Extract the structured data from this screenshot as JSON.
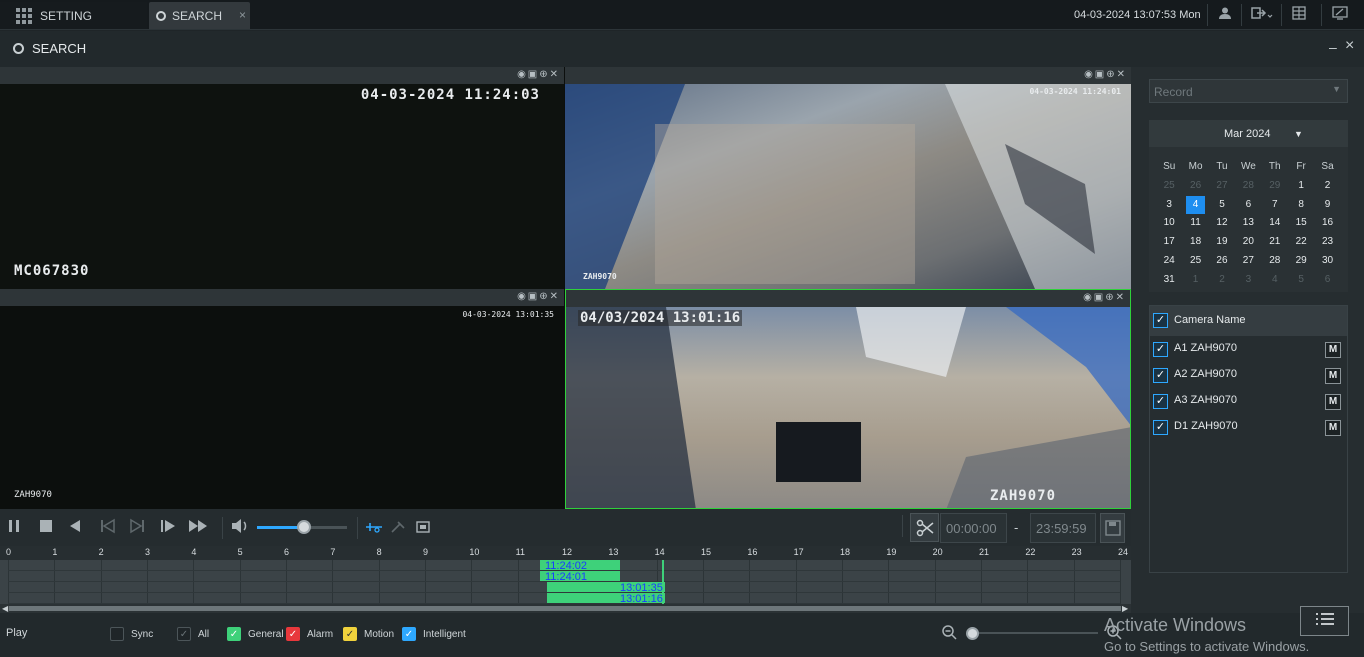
{
  "tabs": {
    "setting": "SETTING",
    "search": "SEARCH",
    "close": "×"
  },
  "clock": "04-03-2024 13:07:53 Mon",
  "window": {
    "title": "SEARCH",
    "minimize": "–",
    "close": "×"
  },
  "osd": {
    "cam1_time": "04-03-2024 11:24:03",
    "cam1_name": "MC067830",
    "cam2_time": "04-03-2024 11:24:01",
    "cam2_name": "ZAH9070",
    "cam3_time": "04-03-2024 13:01:35",
    "cam3_name": "ZAH9070",
    "cam4_time": "04/03/2024 13:01:16",
    "cam4_name": "ZAH9070"
  },
  "clip": {
    "start": "00:00:00",
    "sep": "-",
    "end": "23:59:59"
  },
  "timeline": {
    "hours": [
      "0",
      "1",
      "2",
      "3",
      "4",
      "5",
      "6",
      "7",
      "8",
      "9",
      "10",
      "11",
      "12",
      "13",
      "14",
      "15",
      "16",
      "17",
      "18",
      "19",
      "20",
      "21",
      "22",
      "23",
      "24"
    ],
    "labels": [
      "11:24:02",
      "11:24:01",
      "13:01:35",
      "13:01:16"
    ]
  },
  "footer": {
    "play": "Play",
    "sync": "Sync",
    "all": "All",
    "general": "General",
    "alarm": "Alarm",
    "motion": "Motion",
    "intelligent": "Intelligent"
  },
  "colors": {
    "general": "#3ed17a",
    "alarm": "#e8383c",
    "motion": "#f0d23c",
    "intelligent": "#2ea8ff",
    "accent": "#1e8ef0"
  },
  "side": {
    "record_placeholder": "Record",
    "month": "Mar 2024",
    "weekdays": [
      "Su",
      "Mo",
      "Tu",
      "We",
      "Th",
      "Fr",
      "Sa"
    ],
    "days": [
      "25",
      "26",
      "27",
      "28",
      "29",
      "1",
      "2",
      "3",
      "4",
      "5",
      "6",
      "7",
      "8",
      "9",
      "10",
      "11",
      "12",
      "13",
      "14",
      "15",
      "16",
      "17",
      "18",
      "19",
      "20",
      "21",
      "22",
      "23",
      "24",
      "25",
      "26",
      "27",
      "28",
      "29",
      "30",
      "31",
      "1",
      "2",
      "3",
      "4",
      "5",
      "6"
    ],
    "camera_header": "Camera Name",
    "cameras": [
      "A1 ZAH9070",
      "A2 ZAH9070",
      "A3 ZAH9070",
      "D1 ZAH9070"
    ],
    "m_label": "M"
  },
  "watermark": {
    "line1": "Activate Windows",
    "line2": "Go to Settings to activate Windows."
  }
}
